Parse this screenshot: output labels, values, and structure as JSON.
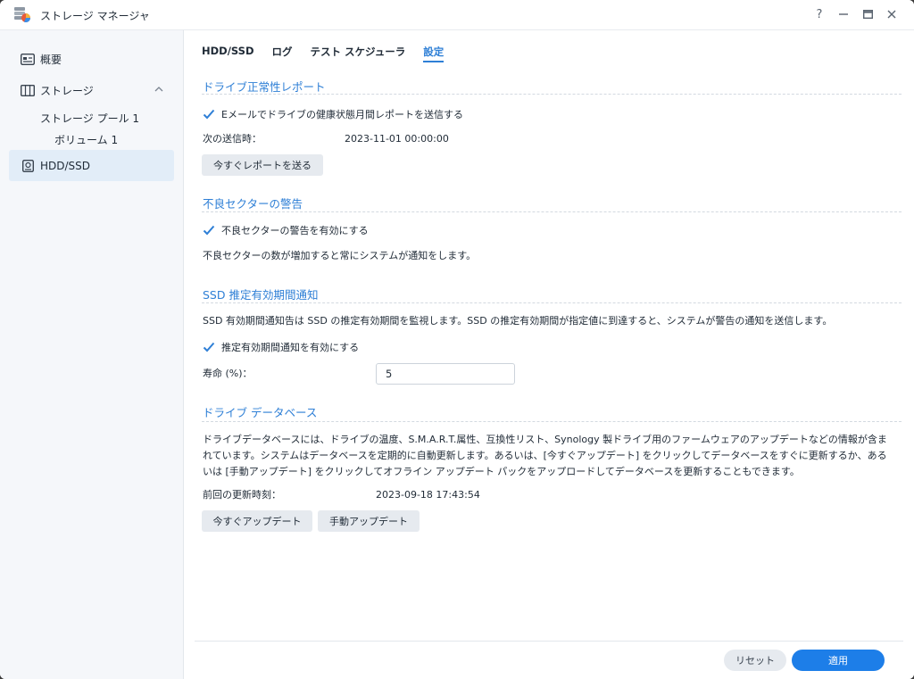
{
  "window": {
    "title": "ストレージ マネージャ"
  },
  "window_controls": {
    "help": "?",
    "minimize": "—",
    "maximize": "▭",
    "close": "✕"
  },
  "sidebar": {
    "items": [
      {
        "label": "概要",
        "icon": "overview-icon"
      },
      {
        "label": "ストレージ",
        "icon": "storage-icon"
      },
      {
        "label": "ストレージ プール 1"
      },
      {
        "label": "ボリューム 1"
      },
      {
        "label": "HDD/SSD",
        "icon": "hdd-icon"
      }
    ]
  },
  "tabs": [
    "HDD/SSD",
    "ログ",
    "テスト スケジューラ",
    "設定"
  ],
  "sections": {
    "health_report": {
      "title": "ドライブ正常性レポート",
      "checkbox_label": "Eメールでドライブの健康状態月間レポートを送信する",
      "next_send_label": "次の送信時：",
      "next_send_value": "2023-11-01 00:00:00",
      "send_now_button": "今すぐレポートを送る"
    },
    "bad_sector": {
      "title": "不良セクターの警告",
      "checkbox_label": "不良セクターの警告を有効にする",
      "description": "不良セクターの数が増加すると常にシステムが通知をします。"
    },
    "ssd_lifespan": {
      "title": "SSD 推定有効期間通知",
      "description": "SSD 有効期間通知告は SSD の推定有効期間を監視します。SSD の推定有効期間が指定値に到達すると、システムが警告の通知を送信します。",
      "checkbox_label": "推定有効期間通知を有効にする",
      "lifespan_label": "寿命 (%)：",
      "lifespan_value": "5"
    },
    "drive_db": {
      "title": "ドライブ データベース",
      "description_line1": "ドライブデータベースには、ドライブの温度、S.M.A.R.T.属性、互換性リスト、Synology 製ドライブ用のファームウェアのアップデートなどの情報が含ま",
      "description_line2": "れています。システムはデータベースを定期的に自動更新します。あるいは、[今すぐアップデート] をクリックしてデータベースをすぐに更新するか、ある",
      "description_line3": "いは [手動アップデート] をクリックしてオフライン アップデート パックをアップロードしてデータベースを更新することもできます。",
      "last_update_label": "前回の更新時刻：",
      "last_update_value": "2023-09-18 17:43:54",
      "update_now_button": "今すぐアップデート",
      "manual_update_button": "手動アップデート"
    }
  },
  "footer": {
    "reset_button": "リセット",
    "apply_button": "適用"
  },
  "colors": {
    "accent": "#2e7fd6",
    "apply_bg": "#1d7ee8",
    "sidebar_active": "#e2edf8"
  }
}
